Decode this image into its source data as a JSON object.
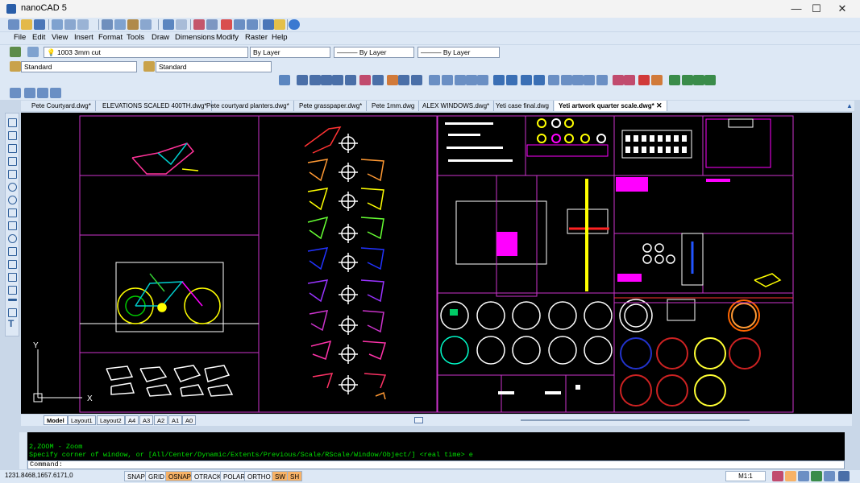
{
  "window": {
    "title": "nanoCAD 5",
    "minimize": "—",
    "maximize": "☐",
    "close": "✕"
  },
  "menu": [
    "File",
    "Edit",
    "View",
    "Insert",
    "Format",
    "Tools",
    "Draw",
    "Dimensions",
    "Modify",
    "Raster",
    "Help"
  ],
  "properties": {
    "layer": "1003 3mm cut",
    "color": "By Layer",
    "linetype": "——— By Layer",
    "lineweight": "——— By Layer"
  },
  "styles": {
    "text_style": "Standard",
    "dim_style": "Standard"
  },
  "tabs": [
    "Pete Courtyard.dwg*",
    "ELEVATIONS SCALED 400TH.dwg*",
    "Pete courtyard planters.dwg*",
    "Pete grasspaper.dwg*",
    "Pete 1mm.dwg",
    "ALEX WINDOWS.dwg*",
    "Yeti case final.dwg",
    "Yeti artwork quarter scale.dwg*"
  ],
  "active_tab_index": 7,
  "layout_tabs": [
    "Model",
    "Layout1",
    "Layout2",
    "A4",
    "A3",
    "A2",
    "A1",
    "A0"
  ],
  "ucs": {
    "y": "Y",
    "x": "X"
  },
  "command": {
    "history_line1": "2,ZOOM - Zoom",
    "history_line2": "Specify corner of window, or [All/Center/Dynamic/Extents/Previous/Scale/RScale/Window/Object/] <real time> e",
    "prompt": "Command:"
  },
  "status": {
    "coords": "1231.8468,1657.6171,0",
    "buttons": [
      "SNAP",
      "GRID",
      "OSNAP",
      "OTRACK",
      "POLAR",
      "ORTHO",
      "SW",
      "SH"
    ],
    "active_buttons": [
      "OSNAP",
      "SW",
      "SH"
    ],
    "scale": "M1:1"
  },
  "colors": {
    "accent": "#f7b267",
    "canvas": "#000000",
    "magenta": "#ff00ff"
  }
}
